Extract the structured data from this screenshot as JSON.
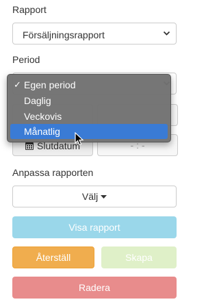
{
  "report": {
    "label": "Rapport",
    "selected": "Försäljningsrapport"
  },
  "period": {
    "label": "Period",
    "options": [
      "Egen period",
      "Daglig",
      "Veckovis",
      "Månatlig"
    ],
    "checked_index": 0,
    "highlighted_index": 3
  },
  "dates": {
    "end_label": "Slutdatum",
    "time_placeholder": "- : -"
  },
  "customize": {
    "label": "Anpassa rapporten",
    "choose": "Välj"
  },
  "buttons": {
    "show_report": "Visa rapport",
    "reset": "Återställ",
    "create": "Skapa",
    "delete": "Radera"
  },
  "colors": {
    "primary_disabled": "#9ad7ea",
    "warning": "#f0ad4e",
    "success_disabled": "#dff0c8",
    "danger": "#e88c8c",
    "menu_highlight": "#3a7bd5"
  },
  "icons": {
    "chevron": "chevron-down-icon",
    "calendar": "calendar-icon",
    "caret": "caret-down-icon",
    "check": "checkmark-icon",
    "cursor": "mouse-pointer-icon"
  }
}
